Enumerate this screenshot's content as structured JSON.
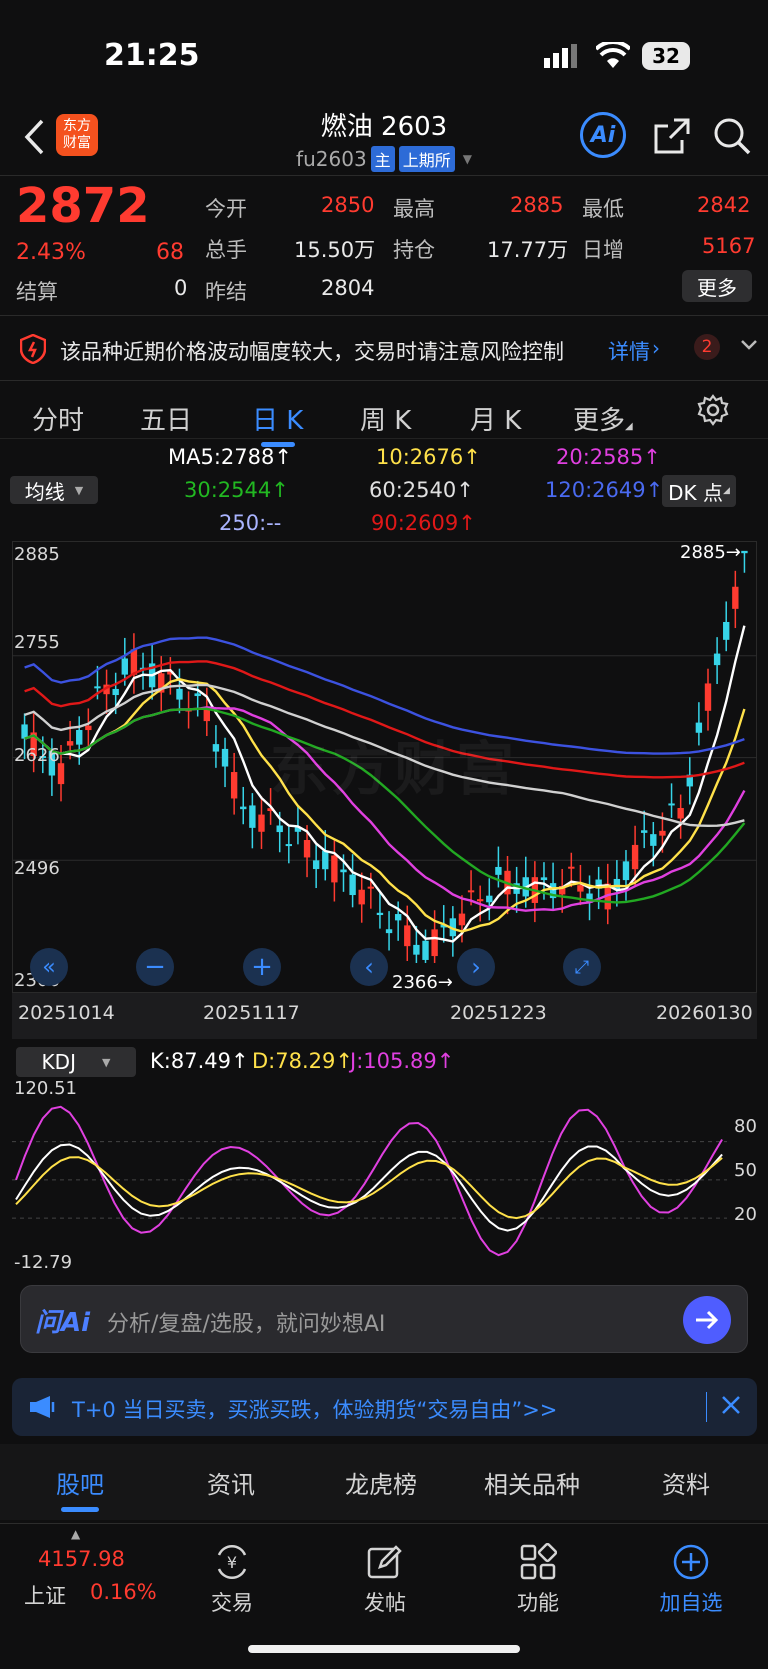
{
  "status_bar": {
    "time": "21:25",
    "battery": "32"
  },
  "header": {
    "logo_line1": "东方",
    "logo_line2": "财富",
    "title": "燃油 2603",
    "subtitle": "fu2603",
    "badge_main": "主",
    "badge_exchange": "上期所",
    "ai_label": "Ai"
  },
  "quote": {
    "price": "2872",
    "change_pct": "2.43%",
    "change": "68",
    "settle_label": "结算",
    "settle_value": "0",
    "open_label": "今开",
    "open_value": "2850",
    "high_label": "最高",
    "high_value": "2885",
    "low_label": "最低",
    "low_value": "2842",
    "volume_label": "总手",
    "volume_value": "15.50万",
    "oi_label": "持仓",
    "oi_value": "17.77万",
    "daily_inc_label": "日增",
    "daily_inc_value": "5167",
    "prev_settle_label": "昨结",
    "prev_settle_value": "2804",
    "more_label": "更多"
  },
  "alert": {
    "text": "该品种近期价格波动幅度较大，交易时请注意风险控制",
    "link": "详情",
    "count": "2"
  },
  "period_tabs": [
    {
      "label": "分时"
    },
    {
      "label": "五日"
    },
    {
      "label": "日 K"
    },
    {
      "label": "周 K"
    },
    {
      "label": "月 K"
    },
    {
      "label": "更多"
    }
  ],
  "ma": {
    "selector": "均线",
    "dk": "DK 点",
    "ma5": "MA5:2788",
    "ma10": "10:2676",
    "ma20": "20:2585",
    "ma30": "30:2544",
    "ma60": "60:2540",
    "ma120": "120:2649",
    "ma250": "250:--",
    "ma90": "90:2609",
    "arrow": "↑"
  },
  "chart_data": {
    "type": "candlestick",
    "y_ticks": [
      "2885",
      "2755",
      "2626",
      "2496",
      "2366"
    ],
    "x_ticks": [
      "20251014",
      "20251117",
      "20251223",
      "20260130"
    ],
    "high_annotation": "2885→",
    "low_annotation": "2366→",
    "ylim": [
      2366,
      2885
    ],
    "colors": {
      "up": "#ff3b30",
      "down": "#37d4e8",
      "ma5": "#ffffff",
      "ma10": "#ffe14a",
      "ma20": "#e040e0",
      "ma30": "#22a822",
      "ma60": "#d0d0d0",
      "ma90": "#e01818",
      "ma120": "#3c52e0"
    }
  },
  "kdj": {
    "selector": "KDJ",
    "k": "K:87.49",
    "d": "D:78.29",
    "j": "J:105.89",
    "arrow": "↑",
    "top": "120.51",
    "bottom": "-12.79",
    "levels": [
      "80",
      "50",
      "20"
    ]
  },
  "ai_input": {
    "brand": "问Ai",
    "placeholder": "分析/复盘/选股，就问妙想AI"
  },
  "promo": {
    "text": "T+0 当日买卖，买涨买跌，体验期货“交易自由”>>"
  },
  "segments": [
    {
      "label": "股吧"
    },
    {
      "label": "资讯"
    },
    {
      "label": "龙虎榜"
    },
    {
      "label": "相关品种"
    },
    {
      "label": "资料"
    }
  ],
  "bottom_nav": {
    "index_value": "4157.98",
    "index_name": "上证",
    "index_pct": "0.16%",
    "items": [
      {
        "label": "交易"
      },
      {
        "label": "发帖"
      },
      {
        "label": "功能"
      },
      {
        "label": "加自选"
      }
    ]
  }
}
